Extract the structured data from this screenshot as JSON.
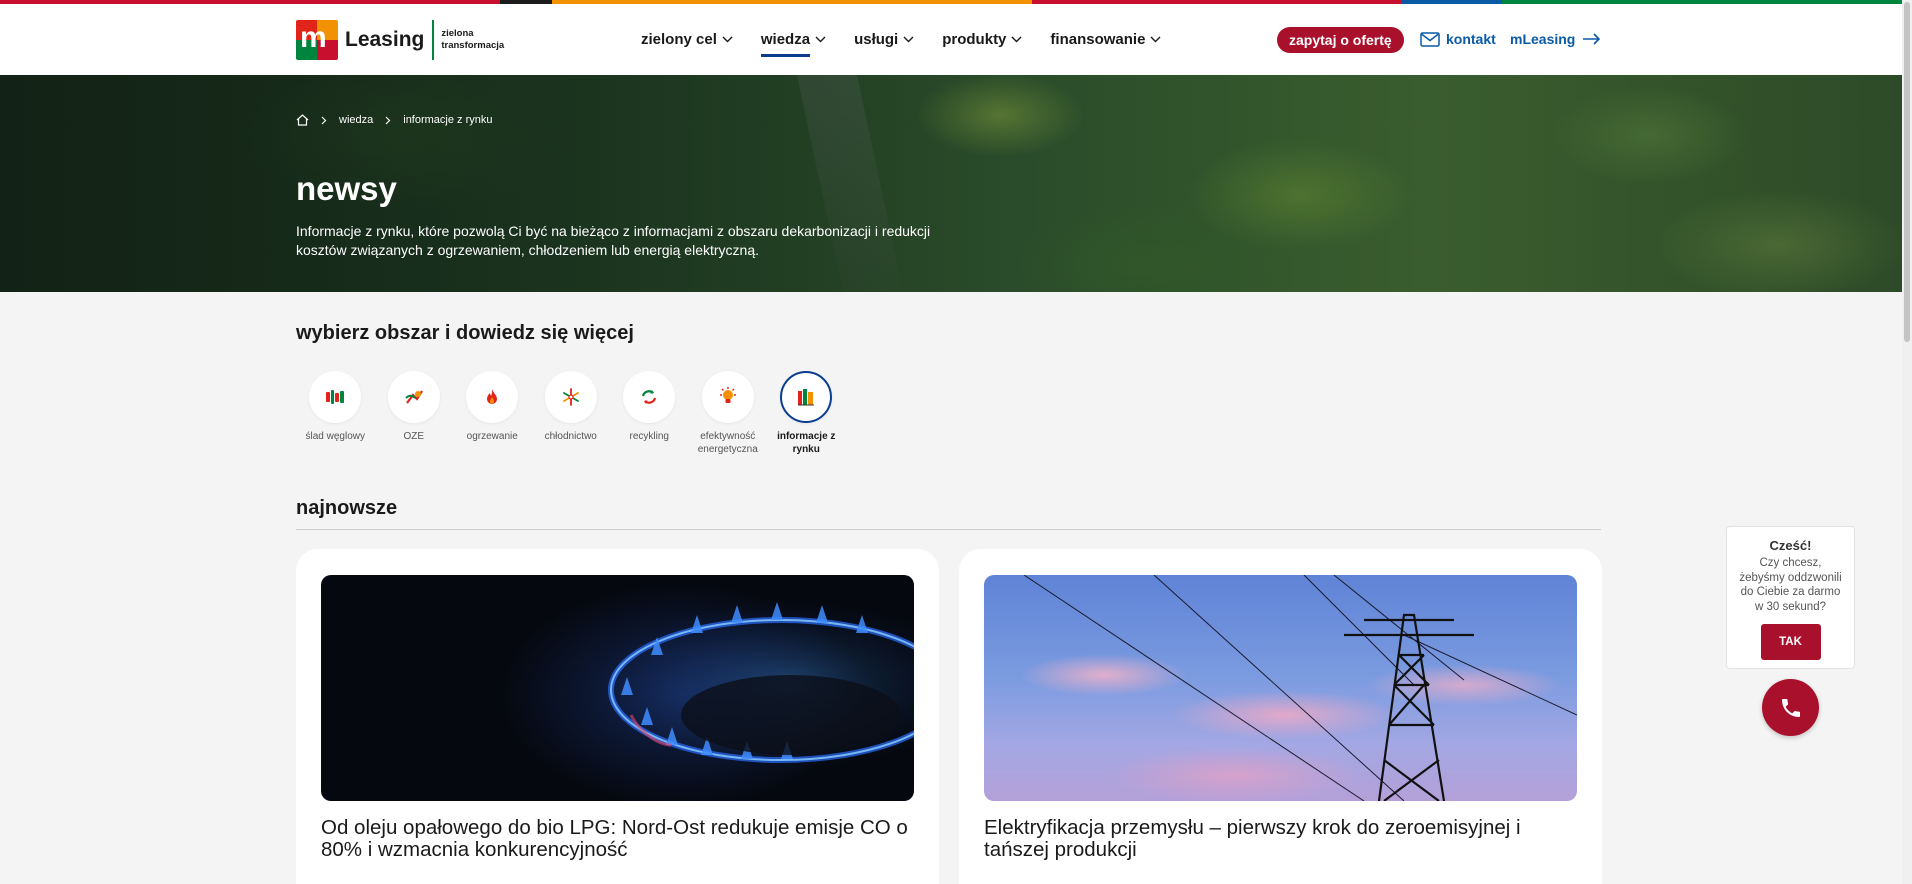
{
  "brand": {
    "name": "Leasing",
    "tagline_line1": "zielona",
    "tagline_line2": "transformacja",
    "strip_colors": [
      "#c8102e",
      "#1b1b1b",
      "#f39200",
      "#c8102e",
      "#0a5aa6",
      "#00853e"
    ]
  },
  "nav": {
    "items": [
      {
        "label": "zielony cel",
        "active": false
      },
      {
        "label": "wiedza",
        "active": true
      },
      {
        "label": "usługi",
        "active": false
      },
      {
        "label": "produkty",
        "active": false
      },
      {
        "label": "finansowanie",
        "active": false
      }
    ],
    "ask_button": "zapytaj o ofertę",
    "contact": "kontakt",
    "mleasing": "mLeasing"
  },
  "breadcrumb": {
    "home_icon": "home-icon",
    "items": [
      "wiedza",
      "informacje z rynku"
    ]
  },
  "hero": {
    "title": "newsy",
    "text": "Informacje z rynku, które pozwolą Ci być na bieżąco z informacjami z obszaru dekarbonizacji i redukcji kosztów związanych z ogrzewaniem, chłodzeniem lub energią elektryczną."
  },
  "areas": {
    "title": "wybierz obszar i dowiedz się więcej",
    "items": [
      {
        "label": "ślad węglowy",
        "icon": "carbon-footprint-icon",
        "active": false
      },
      {
        "label": "OZE",
        "icon": "renewable-energy-icon",
        "active": false
      },
      {
        "label": "ogrzewanie",
        "icon": "flame-icon",
        "active": false
      },
      {
        "label": "chłodnictwo",
        "icon": "snowflake-icon",
        "active": false
      },
      {
        "label": "recykling",
        "icon": "recycle-icon",
        "active": false
      },
      {
        "label": "efektywność energetyczna",
        "icon": "lightbulb-icon",
        "active": false
      },
      {
        "label": "informacje z rynku",
        "icon": "books-icon",
        "active": true
      }
    ]
  },
  "newest": {
    "title": "najnowsze",
    "cards": [
      {
        "title": "Od oleju opałowego do bio LPG: Nord-Ost redukuje emisje CO o 80% i wzmacnia konkurencyjność",
        "image": "gas-burner-photo"
      },
      {
        "title": "Elektryfikacja przemysłu – pierwszy krok do zeroemisyjnej i tańszej produkcji",
        "image": "power-pylon-photo"
      }
    ]
  },
  "callback": {
    "title": "Cześć!",
    "text": "Czy chcesz, żebyśmy oddzwonili do Ciebie za darmo w 30 sekund?",
    "button": "TAK",
    "phone_icon": "phone-icon"
  },
  "colors": {
    "accent_red": "#a8102c",
    "accent_blue": "#0a3d8f",
    "link_blue": "#0a5aa6"
  }
}
